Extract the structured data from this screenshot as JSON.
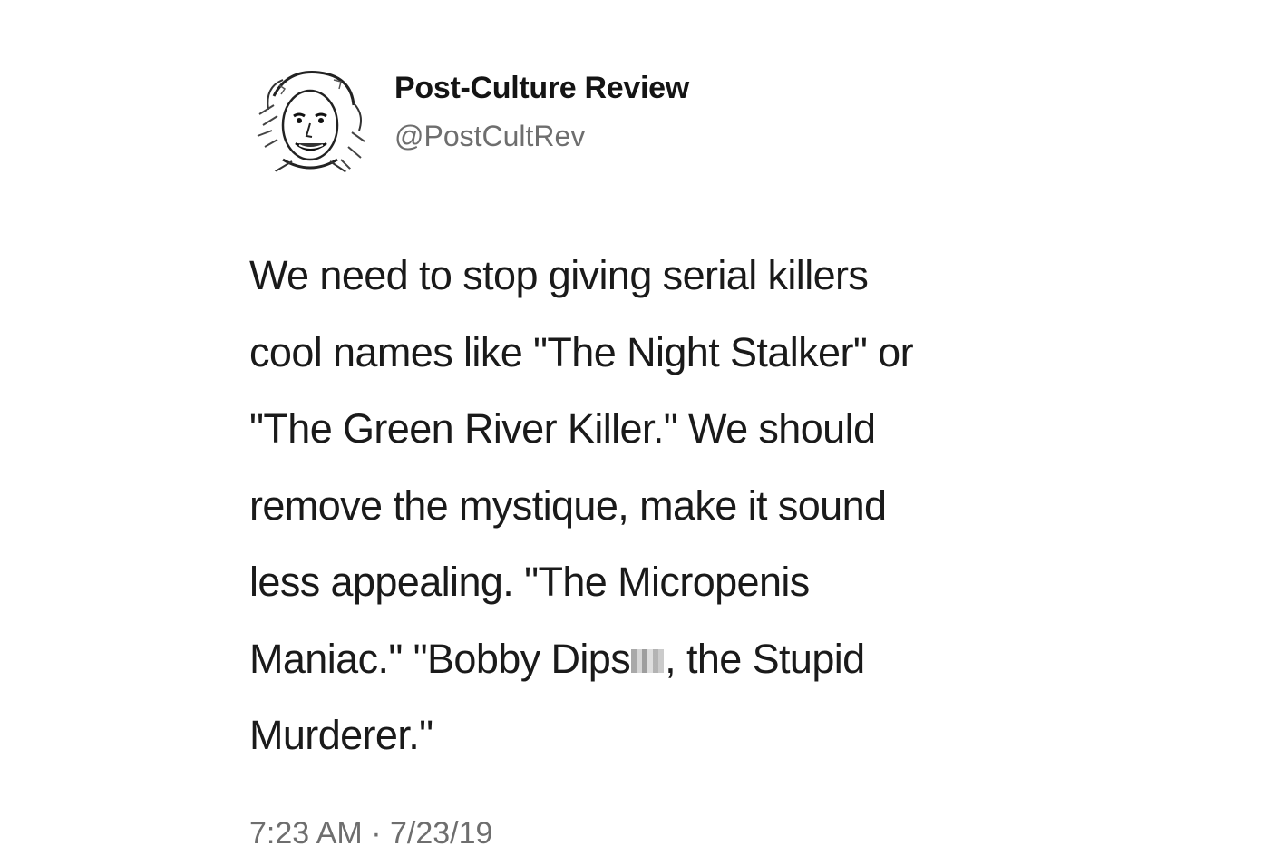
{
  "tweet": {
    "display_name": "Post-Culture Review",
    "handle": "@PostCultRev",
    "body_lines": [
      "We need to stop giving serial killers",
      "cool names like \"The Night Stalker\" or",
      "\"The Green River Killer.\" We should",
      "remove the mystique, make it sound",
      "less appealing. \"The Micropenis"
    ],
    "line6_before": "Maniac.\" \"Bobby Dips",
    "line6_after": ", the Stupid",
    "line7": "Murderer.\"",
    "timestamp": "7:23 AM · 7/23/19"
  }
}
